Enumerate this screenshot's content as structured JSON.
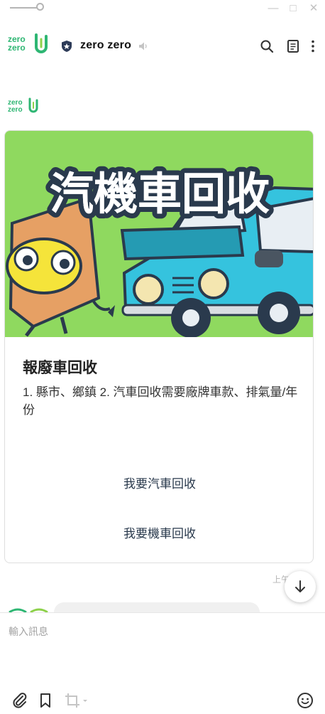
{
  "window": {
    "minimize_glyph": "—",
    "maximize_glyph": "□",
    "close_glyph": "✕"
  },
  "header": {
    "logo_line1": "zero",
    "logo_line2": "zero",
    "chat_name": "zero zero"
  },
  "message": {
    "avatar_line1": "zero",
    "avatar_line2": "zero",
    "hero_text": "汽機車回收",
    "title": "報廢車回收",
    "description": "1. 縣市、鄉鎮  2. 汽車回收需要廠牌車款、排氣量/年份",
    "buttons": [
      "我要汽車回收",
      "我要機車回收"
    ],
    "time": "上午 9:29"
  },
  "composer": {
    "placeholder": "輸入訊息"
  },
  "icons": {
    "header": [
      "shield-star-icon",
      "speaker-muted-icon",
      "search-icon",
      "notes-icon",
      "more-vertical-icon"
    ],
    "toolbar": [
      "paperclip-icon",
      "bookmark-icon",
      "crop-icon",
      "emoji-icon"
    ],
    "scroll": "arrow-down-icon"
  },
  "colors": {
    "brand_green": "#2eb673",
    "hero_bg": "#8fd95f",
    "car": "#35c3de"
  }
}
